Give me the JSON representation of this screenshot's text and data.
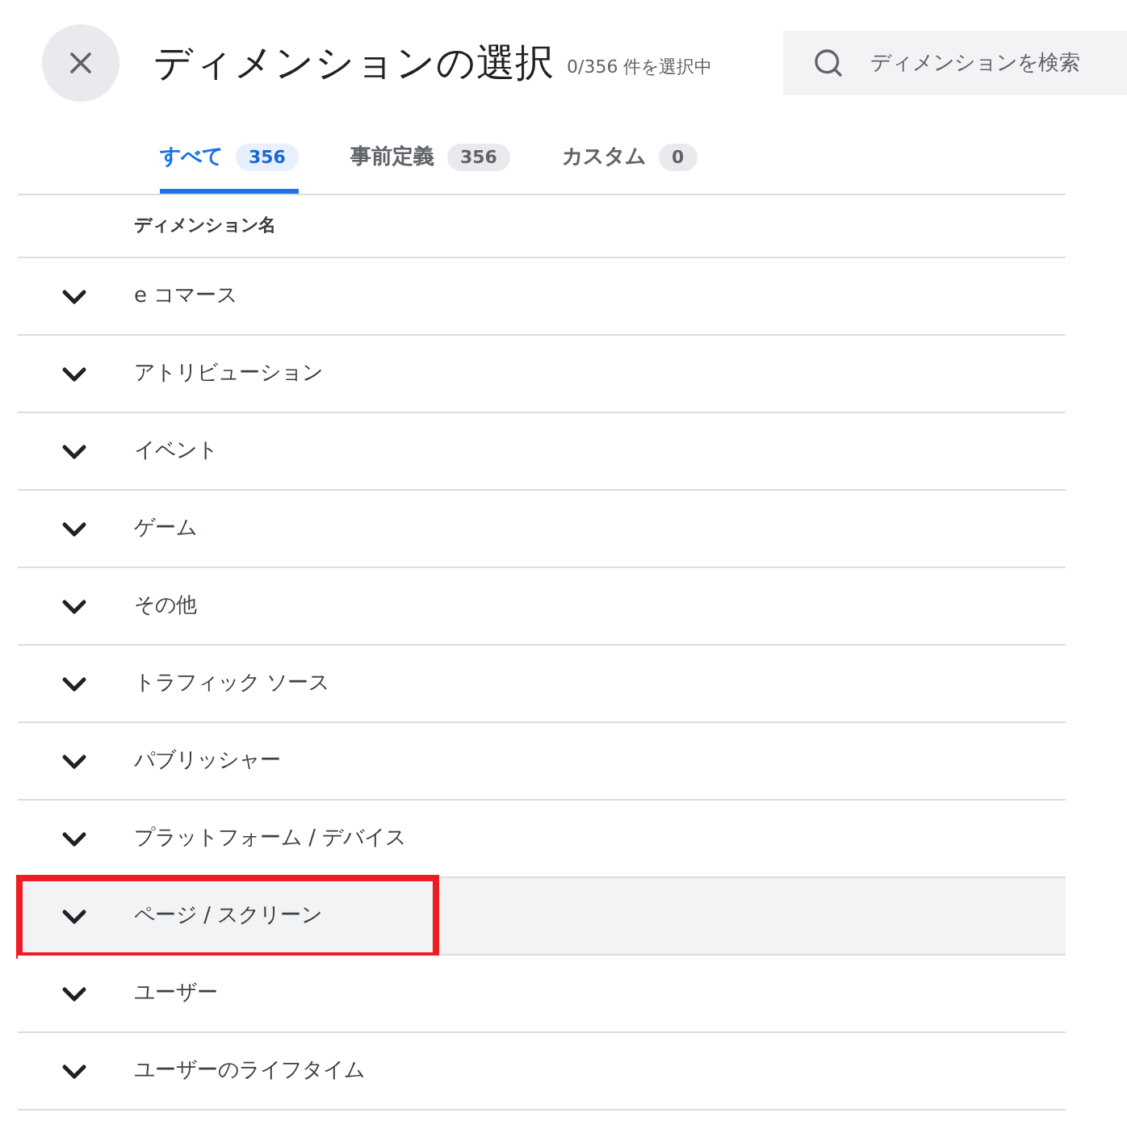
{
  "header": {
    "title": "ディメンションの選択",
    "selection_count": "0/356 件を選択中",
    "search": {
      "placeholder": "ディメンションを検索"
    }
  },
  "tabs": [
    {
      "label": "すべて",
      "count": "356",
      "selected": true
    },
    {
      "label": "事前定義",
      "count": "356",
      "selected": false
    },
    {
      "label": "カスタム",
      "count": "0",
      "selected": false
    }
  ],
  "table": {
    "column": "ディメンション名",
    "rows": [
      {
        "label": "e コマース",
        "highlighted": false
      },
      {
        "label": "アトリビューション",
        "highlighted": false
      },
      {
        "label": "イベント",
        "highlighted": false
      },
      {
        "label": "ゲーム",
        "highlighted": false
      },
      {
        "label": "その他",
        "highlighted": false
      },
      {
        "label": "トラフィック ソース",
        "highlighted": false
      },
      {
        "label": "パブリッシャー",
        "highlighted": false
      },
      {
        "label": "プラットフォーム / デバイス",
        "highlighted": false
      },
      {
        "label": "ページ / スクリーン",
        "highlighted": true
      },
      {
        "label": "ユーザー",
        "highlighted": false
      },
      {
        "label": "ユーザーのライフタイム",
        "highlighted": false
      }
    ]
  }
}
